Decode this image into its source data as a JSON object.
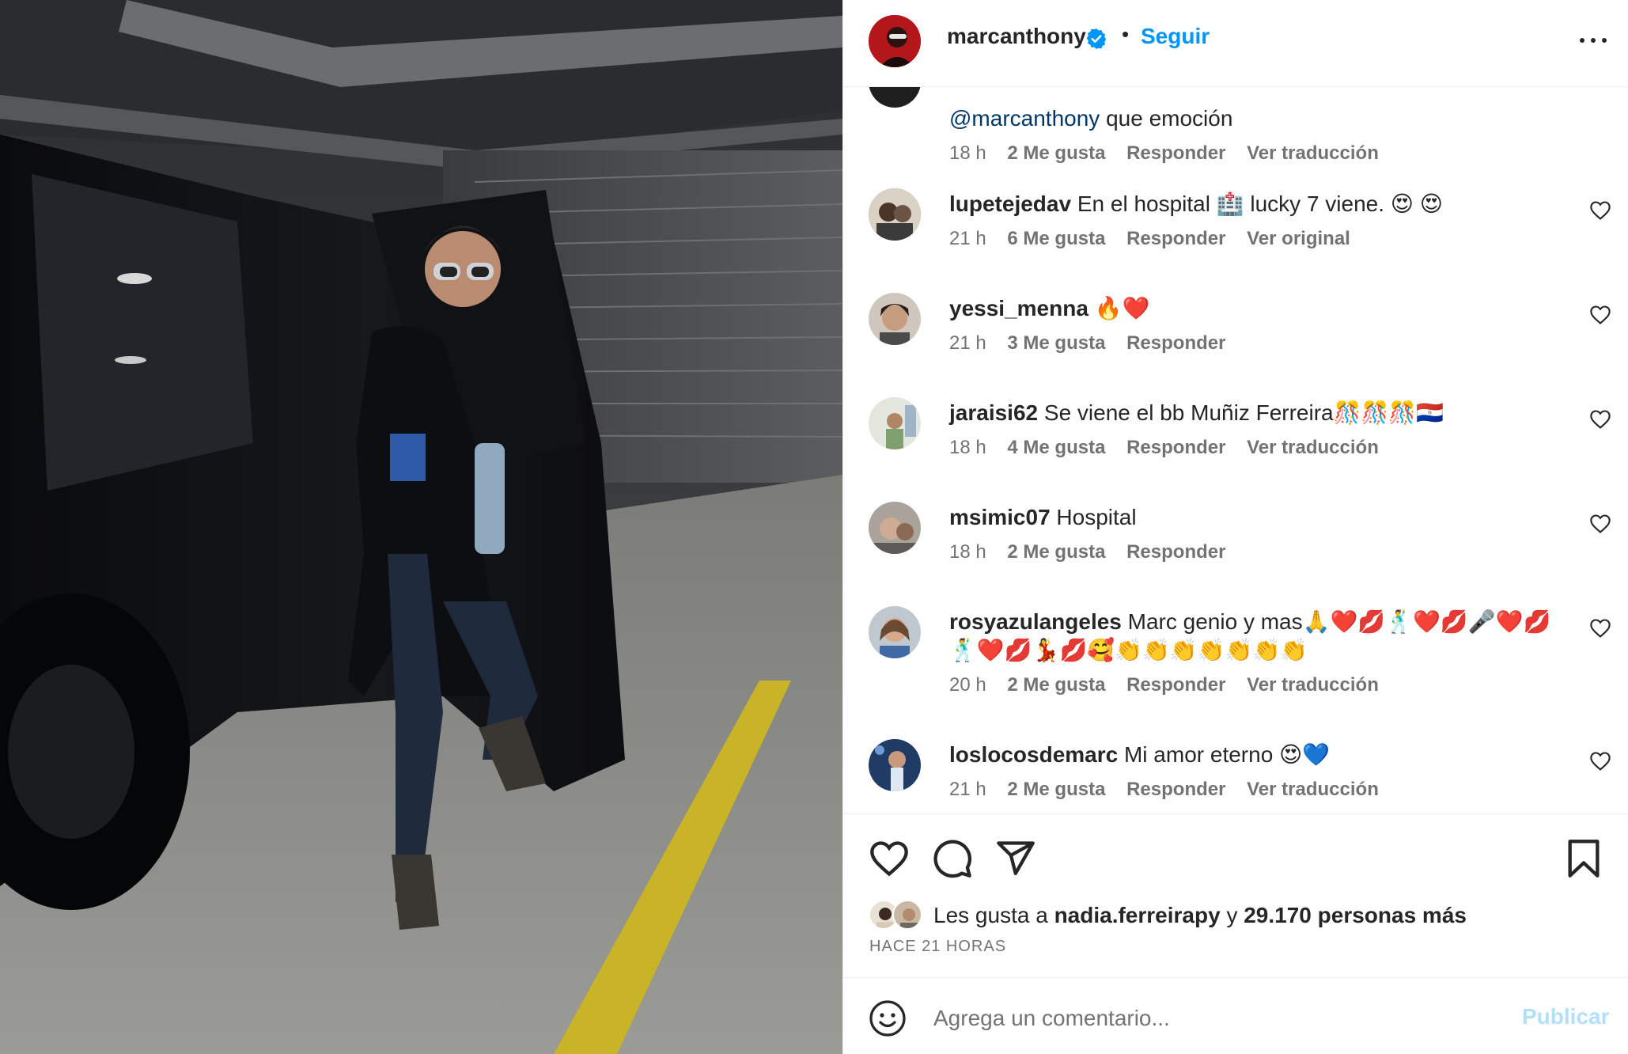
{
  "header": {
    "username": "marcanthony",
    "separator": "•",
    "follow_label": "Seguir"
  },
  "comments": [
    {
      "user": "",
      "text_mention": "@marcanthony",
      "text": " que emoción",
      "time": "18 h",
      "likes": "2 Me gusta",
      "reply": "Responder",
      "translate": "Ver traducción"
    },
    {
      "user": "lupetejedav",
      "text": " En el hospital 🏥 lucky 7 viene. 😍 😍",
      "time": "21 h",
      "likes": "6 Me gusta",
      "reply": "Responder",
      "translate": "Ver original"
    },
    {
      "user": "yessi_menna",
      "text": " 🔥❤️",
      "time": "21 h",
      "likes": "3 Me gusta",
      "reply": "Responder",
      "translate": ""
    },
    {
      "user": "jaraisi62",
      "text": " Se viene el bb Muñiz Ferreira🎊🎊🎊🇵🇾",
      "time": "18 h",
      "likes": "4 Me gusta",
      "reply": "Responder",
      "translate": "Ver traducción"
    },
    {
      "user": "msimic07",
      "text": " Hospital",
      "time": "18 h",
      "likes": "2 Me gusta",
      "reply": "Responder",
      "translate": ""
    },
    {
      "user": "rosyazulangeles",
      "text": " Marc genio y mas🙏❤️💋🕺❤️💋🎤❤️💋🕺❤️💋💃💋🥰👏👏👏👏👏👏👏",
      "time": "20 h",
      "likes": "2 Me gusta",
      "reply": "Responder",
      "translate": "Ver traducción"
    },
    {
      "user": "loslocosdemarc",
      "text": " Mi amor eterno 😍💙",
      "time": "21 h",
      "likes": "2 Me gusta",
      "reply": "Responder",
      "translate": "Ver traducción"
    }
  ],
  "likes_line": {
    "prefix": "Les gusta a ",
    "user": "nadia.ferreirapy",
    "middle": " y ",
    "count": "29.170 personas más"
  },
  "timestamp": "HACE 21 HORAS",
  "comment_box": {
    "placeholder": "Agrega un comentario...",
    "post_label": "Publicar"
  },
  "icons": {
    "like": "heart-icon",
    "comment": "comment-bubble-icon",
    "share": "paper-plane-icon",
    "save": "bookmark-icon",
    "emoji": "smiley-icon",
    "verified": "verified-badge-icon",
    "more": "more-options-icon"
  },
  "colors": {
    "accent": "#0095f6",
    "muted": "#737373",
    "text": "#262626",
    "publish_disabled": "#b2dffc",
    "mention": "#00376b"
  }
}
